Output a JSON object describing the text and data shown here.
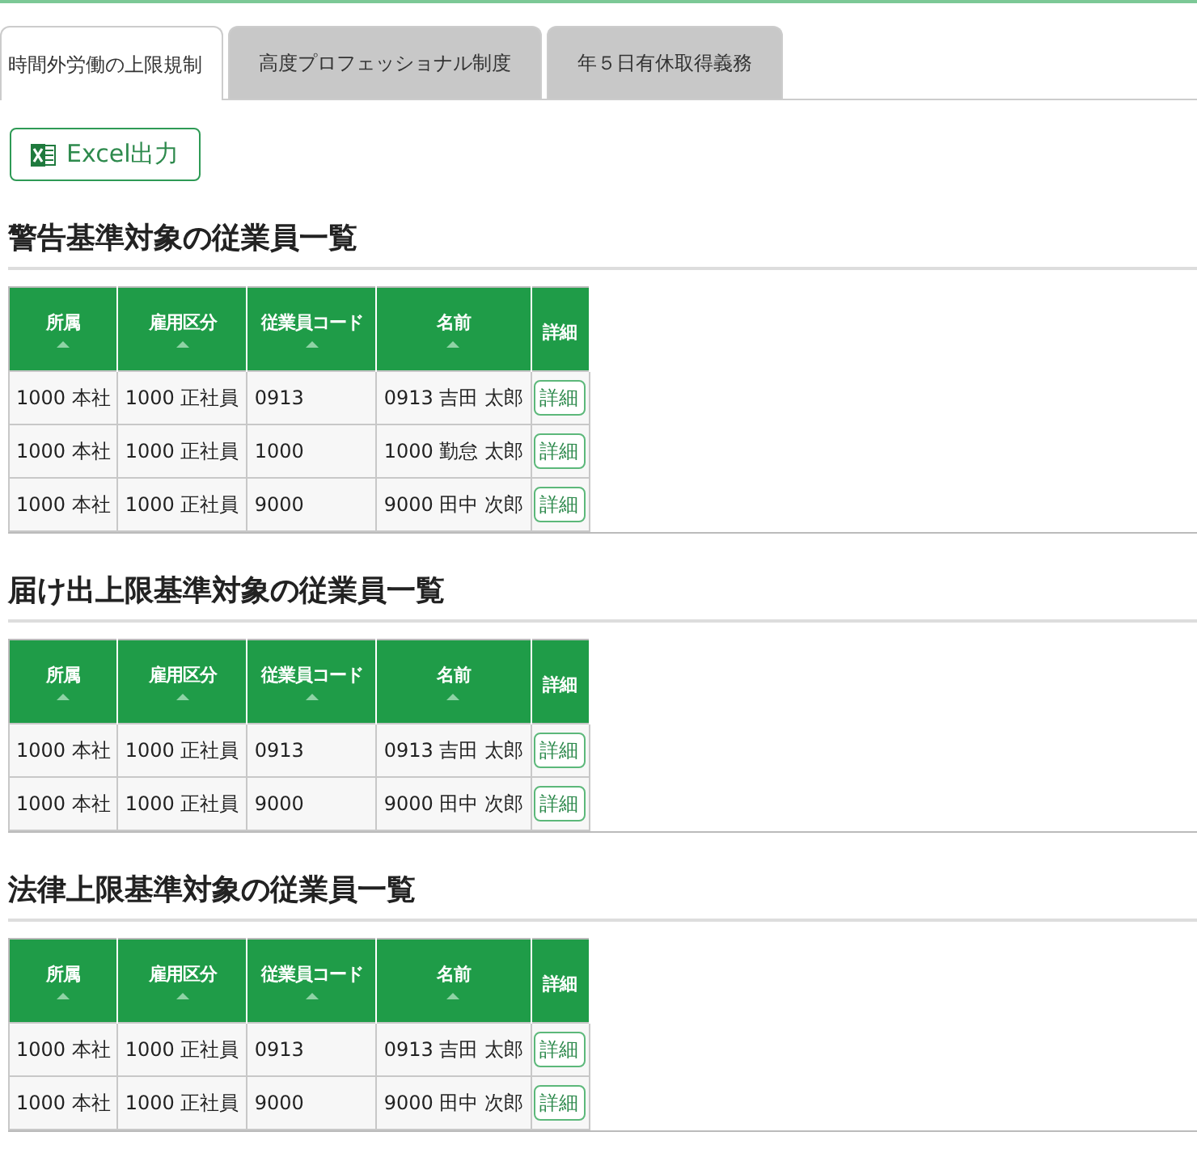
{
  "tabs": [
    {
      "label": "時間外労働の上限規制",
      "selected": true
    },
    {
      "label": "高度プロフェッショナル制度",
      "selected": false
    },
    {
      "label": "年５日有休取得義務",
      "selected": false
    }
  ],
  "export_button": {
    "label": "Excel出力"
  },
  "sections": [
    {
      "title": "警告基準対象の従業員一覧",
      "columns": [
        {
          "label": "所属",
          "sortable": true
        },
        {
          "label": "雇用区分",
          "sortable": true
        },
        {
          "label": "従業員コード",
          "sortable": true
        },
        {
          "label": "名前",
          "sortable": true
        },
        {
          "label": "詳細",
          "sortable": false
        }
      ],
      "rows": [
        {
          "cells": [
            "1000 本社",
            "1000 正社員",
            "0913",
            "0913 吉田 太郎"
          ],
          "action": "詳細"
        },
        {
          "cells": [
            "1000 本社",
            "1000 正社員",
            "1000",
            "1000 勤怠 太郎"
          ],
          "action": "詳細"
        },
        {
          "cells": [
            "1000 本社",
            "1000 正社員",
            "9000",
            "9000 田中 次郎"
          ],
          "action": "詳細"
        }
      ]
    },
    {
      "title": "届け出上限基準対象の従業員一覧",
      "columns": [
        {
          "label": "所属",
          "sortable": true
        },
        {
          "label": "雇用区分",
          "sortable": true
        },
        {
          "label": "従業員コード",
          "sortable": true
        },
        {
          "label": "名前",
          "sortable": true
        },
        {
          "label": "詳細",
          "sortable": false
        }
      ],
      "rows": [
        {
          "cells": [
            "1000 本社",
            "1000 正社員",
            "0913",
            "0913 吉田 太郎"
          ],
          "action": "詳細"
        },
        {
          "cells": [
            "1000 本社",
            "1000 正社員",
            "9000",
            "9000 田中 次郎"
          ],
          "action": "詳細"
        }
      ]
    },
    {
      "title": "法律上限基準対象の従業員一覧",
      "columns": [
        {
          "label": "所属",
          "sortable": true
        },
        {
          "label": "雇用区分",
          "sortable": true
        },
        {
          "label": "従業員コード",
          "sortable": true
        },
        {
          "label": "名前",
          "sortable": true
        },
        {
          "label": "詳細",
          "sortable": false
        }
      ],
      "rows": [
        {
          "cells": [
            "1000 本社",
            "1000 正社員",
            "0913",
            "0913 吉田 太郎"
          ],
          "action": "詳細"
        },
        {
          "cells": [
            "1000 本社",
            "1000 正社員",
            "9000",
            "9000 田中 次郎"
          ],
          "action": "詳細"
        }
      ]
    }
  ]
}
